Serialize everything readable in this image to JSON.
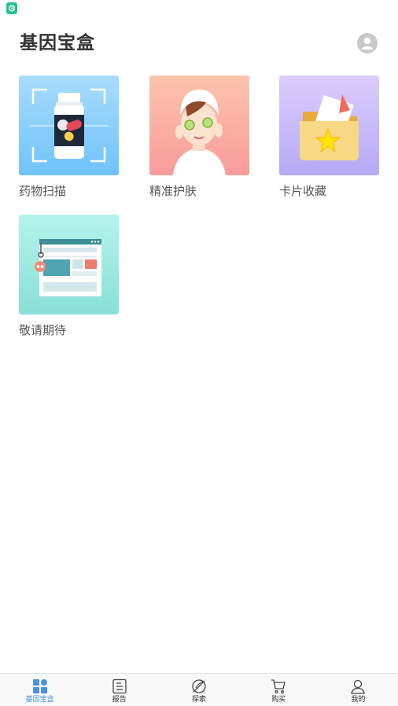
{
  "header": {
    "title": "基因宝盒"
  },
  "tiles": [
    {
      "label": "药物扫描",
      "icon": "pill-bottle-scan-icon"
    },
    {
      "label": "精准护肤",
      "icon": "facial-mask-icon"
    },
    {
      "label": "卡片收藏",
      "icon": "star-folder-icon"
    },
    {
      "label": "敬请期待",
      "icon": "browser-window-icon"
    }
  ],
  "tab_bar": {
    "active_index": 0,
    "active_color": "#4a90e2",
    "tabs": [
      {
        "label": "基因宝盒",
        "icon": "grid-icon"
      },
      {
        "label": "报告",
        "icon": "report-icon"
      },
      {
        "label": "探索",
        "icon": "compass-icon"
      },
      {
        "label": "购买",
        "icon": "cart-icon"
      },
      {
        "label": "我的",
        "icon": "person-icon"
      }
    ]
  }
}
